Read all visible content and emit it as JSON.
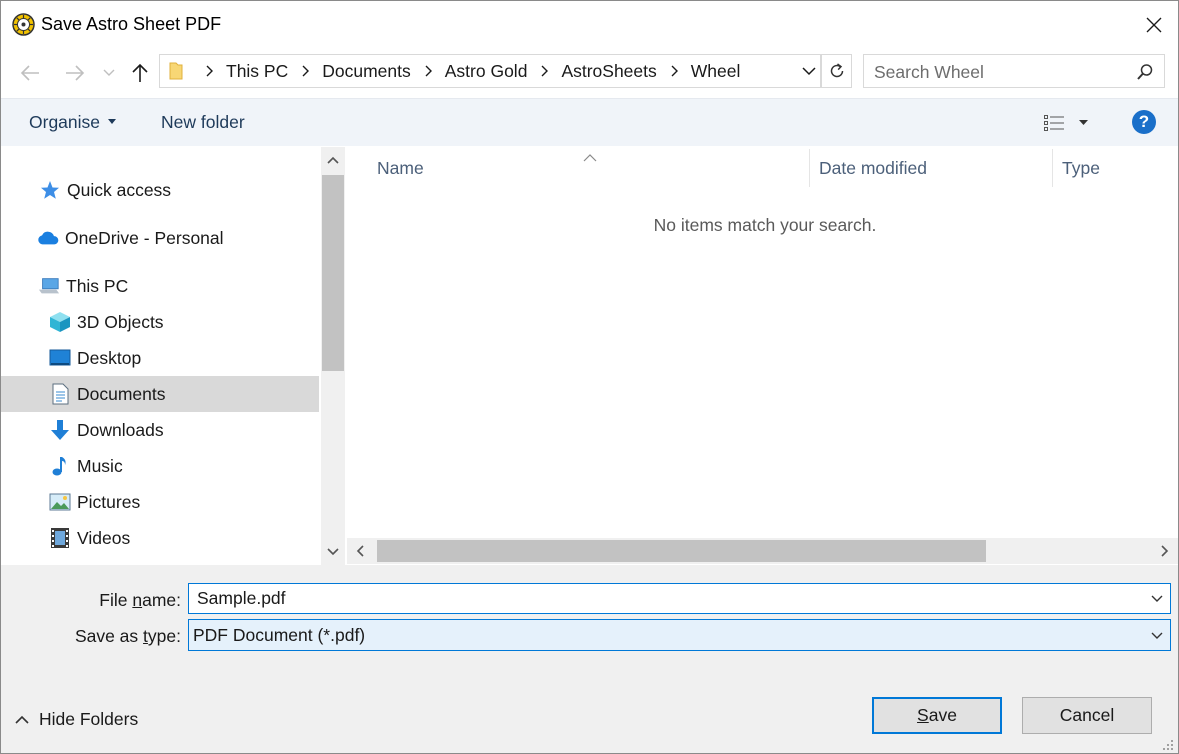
{
  "window": {
    "title": "Save Astro Sheet PDF"
  },
  "address": {
    "breadcrumbs": [
      "This PC",
      "Documents",
      "Astro Gold",
      "AstroSheets",
      "Wheel"
    ]
  },
  "search": {
    "placeholder": "Search Wheel"
  },
  "toolbar": {
    "organise_label": "Organise",
    "new_folder_label": "New folder",
    "help_label": "?"
  },
  "nav": {
    "items": [
      {
        "label": "Quick access",
        "icon": "star-icon"
      },
      {
        "label": "OneDrive - Personal",
        "icon": "cloud-icon"
      },
      {
        "label": "This PC",
        "icon": "computer-icon"
      },
      {
        "label": "3D Objects",
        "icon": "cube-icon"
      },
      {
        "label": "Desktop",
        "icon": "desktop-icon"
      },
      {
        "label": "Documents",
        "icon": "document-icon",
        "selected": true
      },
      {
        "label": "Downloads",
        "icon": "download-arrow-icon"
      },
      {
        "label": "Music",
        "icon": "music-note-icon"
      },
      {
        "label": "Pictures",
        "icon": "picture-icon"
      },
      {
        "label": "Videos",
        "icon": "film-icon"
      }
    ]
  },
  "filelist": {
    "columns": [
      "Name",
      "Date modified",
      "Type"
    ],
    "empty_message": "No items match your search."
  },
  "form": {
    "filename_label_pre": "File ",
    "filename_label_accel": "n",
    "filename_label_post": "ame:",
    "filename_value": "Sample.pdf",
    "savetype_label_pre": "Save as ",
    "savetype_label_accel": "t",
    "savetype_label_post": "ype:",
    "savetype_value": "PDF Document (*.pdf)"
  },
  "footer": {
    "hide_folders_label": "Hide Folders",
    "save_label_accel": "S",
    "save_label_rest": "ave",
    "cancel_label": "Cancel"
  },
  "colors": {
    "accent": "#0078d7",
    "help": "#1a6fc9",
    "selected_row": "#d9d9d9",
    "toolbar_bg": "#f0f4f9"
  }
}
